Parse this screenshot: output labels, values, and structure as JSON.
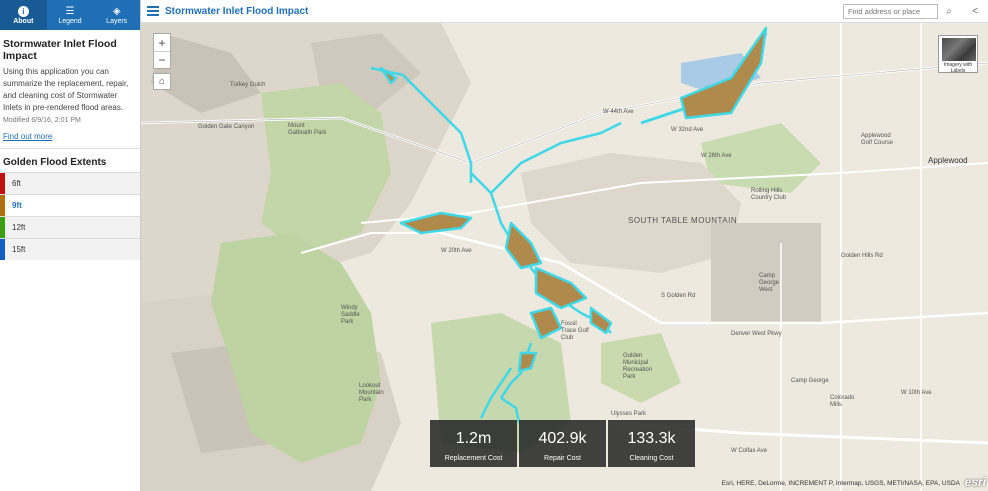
{
  "sidebar": {
    "tabs": [
      {
        "label": "About",
        "icon": "info-icon"
      },
      {
        "label": "Legend",
        "icon": "list-icon"
      },
      {
        "label": "Layers",
        "icon": "layers-icon"
      }
    ],
    "title": "Stormwater Inlet Flood Impact",
    "description": "Using this application you can summarize the replacement, repair, and cleaning cost of Stormwater Inlets in pre-rendered flood areas.",
    "modified": "Modified 6/9/16, 2:01 PM",
    "find_out_more": "Find out more",
    "extents_title": "Golden Flood Extents",
    "extents": [
      {
        "label": "6ft",
        "color": "#c01010"
      },
      {
        "label": "9ft",
        "color": "#b07010"
      },
      {
        "label": "12ft",
        "color": "#3aa010"
      },
      {
        "label": "15ft",
        "color": "#1060c0"
      }
    ],
    "selected_extent": "9ft"
  },
  "header": {
    "title": "Stormwater Inlet Flood Impact",
    "search_placeholder": "Find address or place"
  },
  "map": {
    "basemap_label": "Imagery with Labels",
    "labels": {
      "turkey_gulch": "Turkey Gulch",
      "golden_gate_canyon": "Golden Gate Canyon",
      "south_table": "SOUTH TABLE MOUNTAIN",
      "applewood": "Applewood",
      "applewood_golf": "Applewood Golf Course",
      "rolling_hills": "Rolling Hills Country Club",
      "fossil_trace": "Fossil Trace Golf Club",
      "camp_george": "Camp George West",
      "golden_rec": "Golden Municipal Recreation Park",
      "colorado_mills": "Colorado Mills",
      "w_44th": "W 44th Ave",
      "w_32nd": "W 32nd Ave",
      "w_10th": "W 10th Ave",
      "denver_west": "Denver West Pkwy",
      "lookout": "Lookout Mountain Park",
      "windy_saddle": "Windy Saddle Park",
      "mount_galbraith": "Mount Galbraith Park",
      "ulysses": "Ulysses Park",
      "w_colfax": "W Colfax Ave",
      "golden_hills": "Golden Hills Rd",
      "w_26th": "W 26th Ave",
      "w_20th": "W 20th Ave",
      "golden_rd": "S Golden Rd",
      "camp_george_short": "Camp George"
    },
    "attribution": "Esri, HERE, DeLorme, INCREMENT P, Intermap, USGS, METI/NASA, EPA, USDA",
    "esri_logo": "esri"
  },
  "stats": [
    {
      "value": "1.2m",
      "label": "Replacement Cost"
    },
    {
      "value": "402.9k",
      "label": "Repair Cost"
    },
    {
      "value": "133.3k",
      "label": "Cleaning Cost"
    }
  ]
}
